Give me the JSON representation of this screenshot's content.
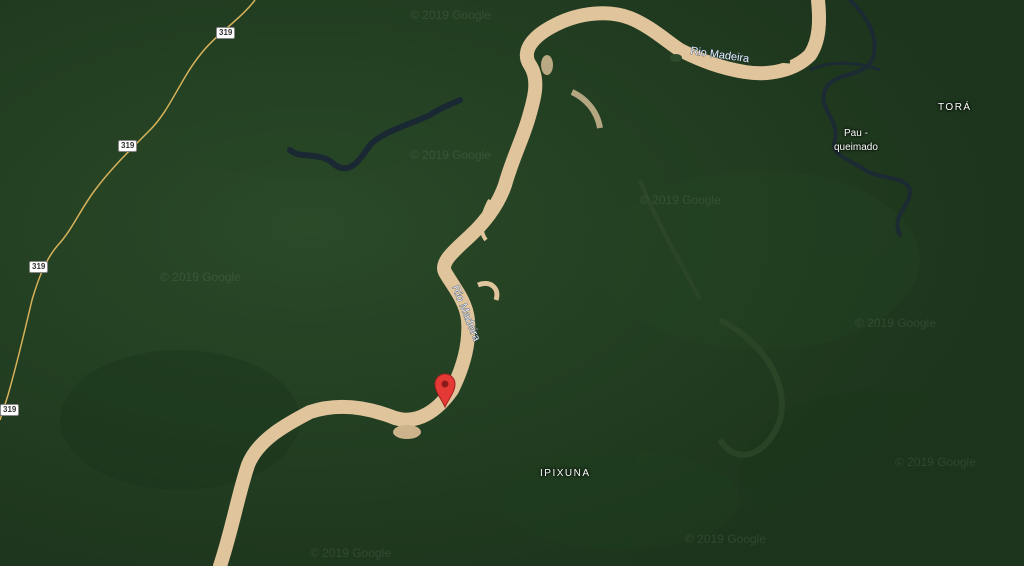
{
  "map": {
    "type": "satellite",
    "colors": {
      "forest": "#1f3a1e",
      "river": "#e0c49c",
      "dark_river": "#1c2a33",
      "road": "#d7b25a",
      "pin": "#e53935"
    },
    "rivers": [
      {
        "name": "Rio Madeira"
      },
      {
        "name": "Rio Madeira"
      }
    ],
    "places": [
      {
        "name": "TORÁ"
      },
      {
        "name": "IPIXUNA"
      }
    ],
    "pois": [
      {
        "name": "Pau -\nqueimado"
      }
    ],
    "road_shields": [
      {
        "label": "319"
      },
      {
        "label": "319"
      },
      {
        "label": "319"
      },
      {
        "label": "319"
      }
    ],
    "watermark": "© 2019 Google",
    "marker": {
      "icon": "map-pin-icon",
      "color": "#e53935"
    }
  }
}
